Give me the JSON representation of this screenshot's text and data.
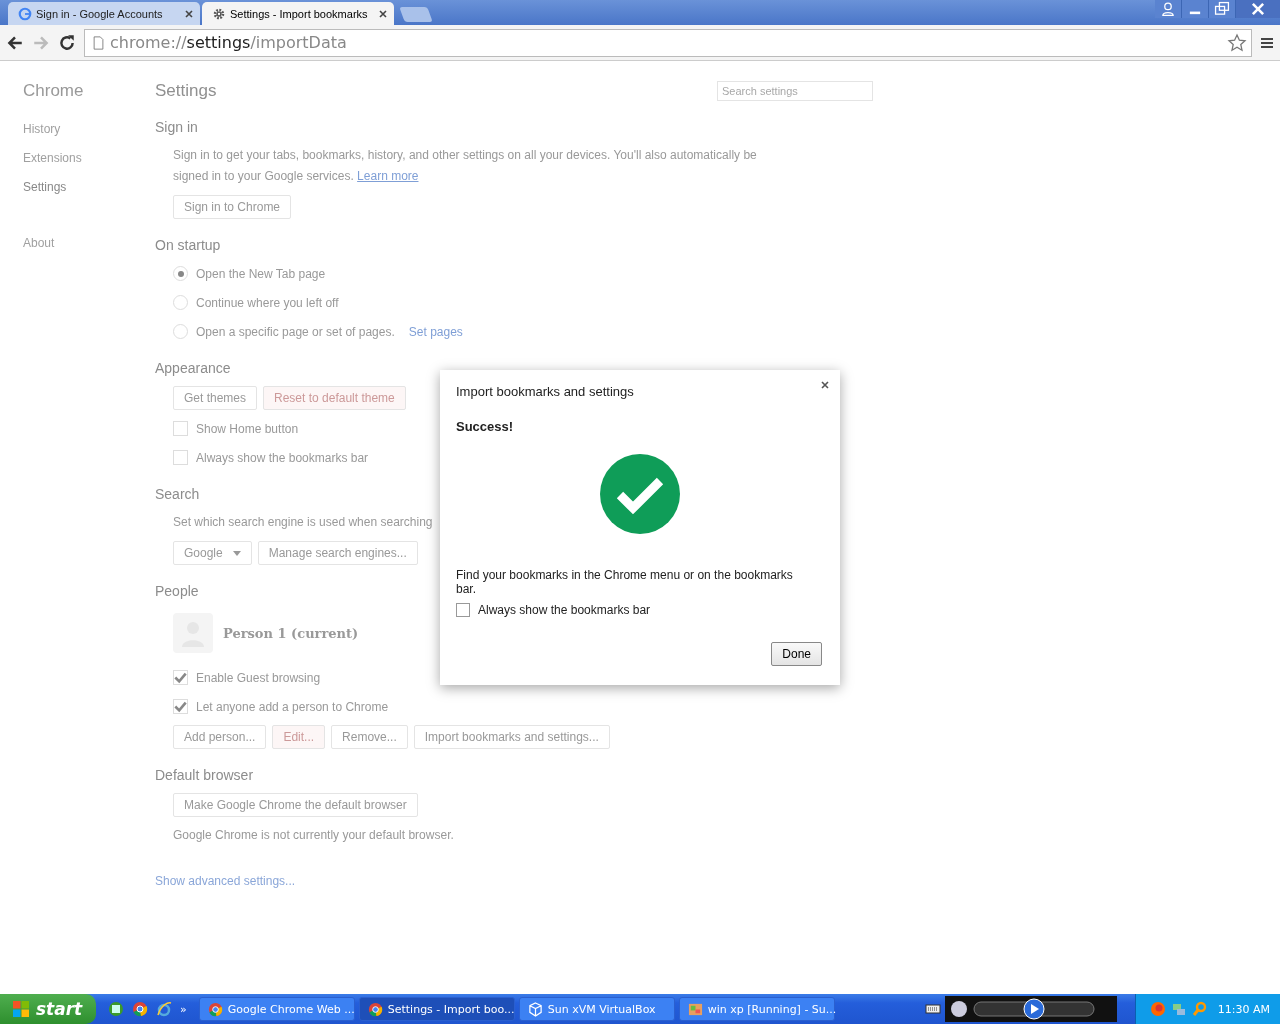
{
  "tabs": [
    {
      "label": "Sign in - Google Accounts",
      "selected": false
    },
    {
      "label": "Settings - Import bookmarks",
      "selected": true
    }
  ],
  "address": {
    "scheme": "chrome://",
    "host": "settings",
    "path": "/importData"
  },
  "sidebar": {
    "title": "Chrome",
    "items": [
      {
        "label": "History",
        "selected": false
      },
      {
        "label": "Extensions",
        "selected": false
      },
      {
        "label": "Settings",
        "selected": true
      },
      {
        "label": "About",
        "selected": false
      }
    ]
  },
  "page": {
    "title": "Settings",
    "search_placeholder": "Search settings"
  },
  "sign_in": {
    "heading": "Sign in",
    "text": "Sign in to get your tabs, bookmarks, history, and other settings on all your devices. You'll also automatically be signed in to your Google services.",
    "link": "Learn more",
    "button": "Sign in to Chrome"
  },
  "startup": {
    "heading": "On startup",
    "options": [
      {
        "label": "Open the New Tab page",
        "selected": true
      },
      {
        "label": "Continue where you left off",
        "selected": false
      },
      {
        "label": "Open a specific page or set of pages.",
        "selected": false,
        "link": "Set pages"
      }
    ]
  },
  "appearance": {
    "heading": "Appearance",
    "buttons": [
      "Get themes",
      "Reset to default theme"
    ],
    "checks": [
      {
        "label": "Show Home button",
        "checked": false
      },
      {
        "label": "Always show the bookmarks bar",
        "checked": false
      }
    ]
  },
  "search": {
    "heading": "Search",
    "text": "Set which search engine is used when searching",
    "engine": "Google",
    "manage": "Manage search engines..."
  },
  "people": {
    "heading": "People",
    "person": "Person 1 (current)",
    "checks": [
      {
        "label": "Enable Guest browsing",
        "checked": true
      },
      {
        "label": "Let anyone add a person to Chrome",
        "checked": true
      }
    ],
    "buttons": [
      "Add person...",
      "Edit...",
      "Remove...",
      "Import bookmarks and settings..."
    ]
  },
  "default_browser": {
    "heading": "Default browser",
    "button": "Make Google Chrome the default browser",
    "text": "Google Chrome is not currently your default browser."
  },
  "advanced_link": "Show advanced settings...",
  "dialog": {
    "title": "Import bookmarks and settings",
    "status": "Success!",
    "message": "Find your bookmarks in the Chrome menu or on the bookmarks bar.",
    "check": {
      "label": "Always show the bookmarks bar",
      "checked": false
    },
    "button": "Done"
  },
  "taskbar": {
    "start": "start",
    "chevron": "»",
    "items": [
      {
        "label": "Google Chrome Web ...",
        "selected": false
      },
      {
        "label": "Settings - Import boo...",
        "selected": true
      },
      {
        "label": "Sun xVM VirtualBox",
        "selected": false
      },
      {
        "label": "win xp [Running] - Su...",
        "selected": false
      }
    ],
    "clock": "11:30 AM"
  }
}
